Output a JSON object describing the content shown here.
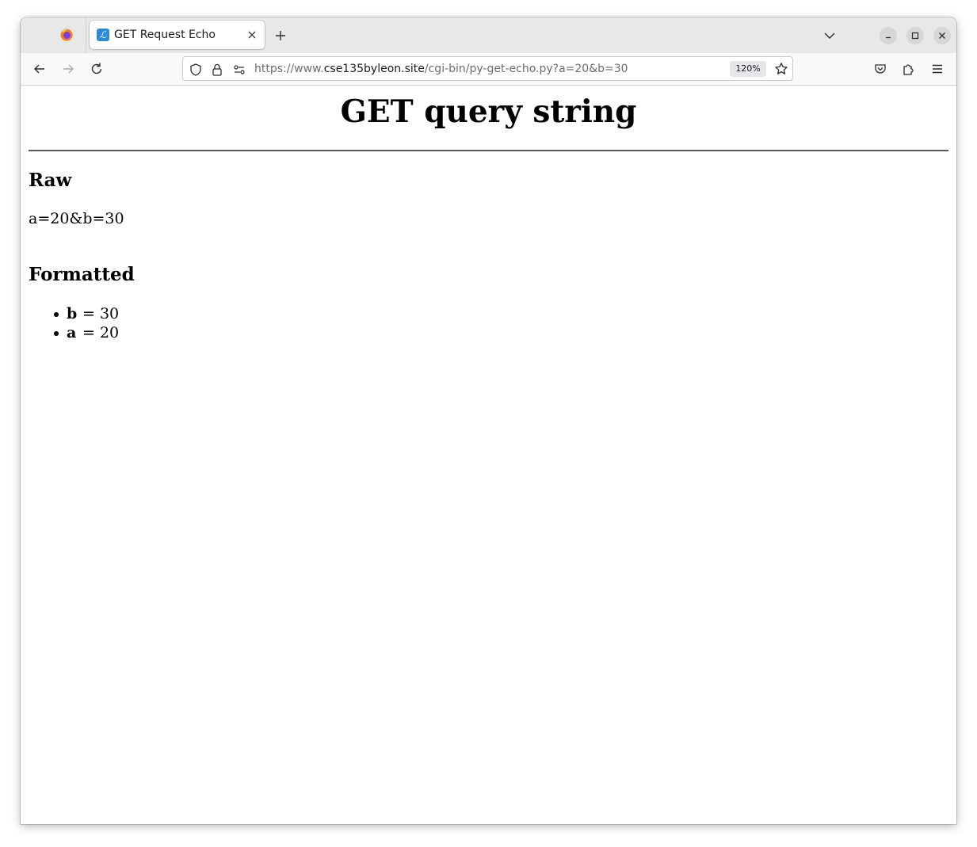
{
  "browser": {
    "tab": {
      "title": "GET Request Echo",
      "favicon_letter": "ℒ",
      "favicon_color": "#2d89d6"
    },
    "url": {
      "scheme": "https://www.",
      "host": "cse135byleon.site",
      "path": "/cgi-bin/py-get-echo.py?a=20&b=30"
    },
    "zoom": "120%"
  },
  "page": {
    "title": "GET query string",
    "raw_heading": "Raw",
    "raw_value": "a=20&b=30",
    "formatted_heading": "Formatted",
    "formatted_items": [
      {
        "key": "b",
        "rest": "= 30"
      },
      {
        "key": "a",
        "rest": "= 20"
      }
    ]
  }
}
